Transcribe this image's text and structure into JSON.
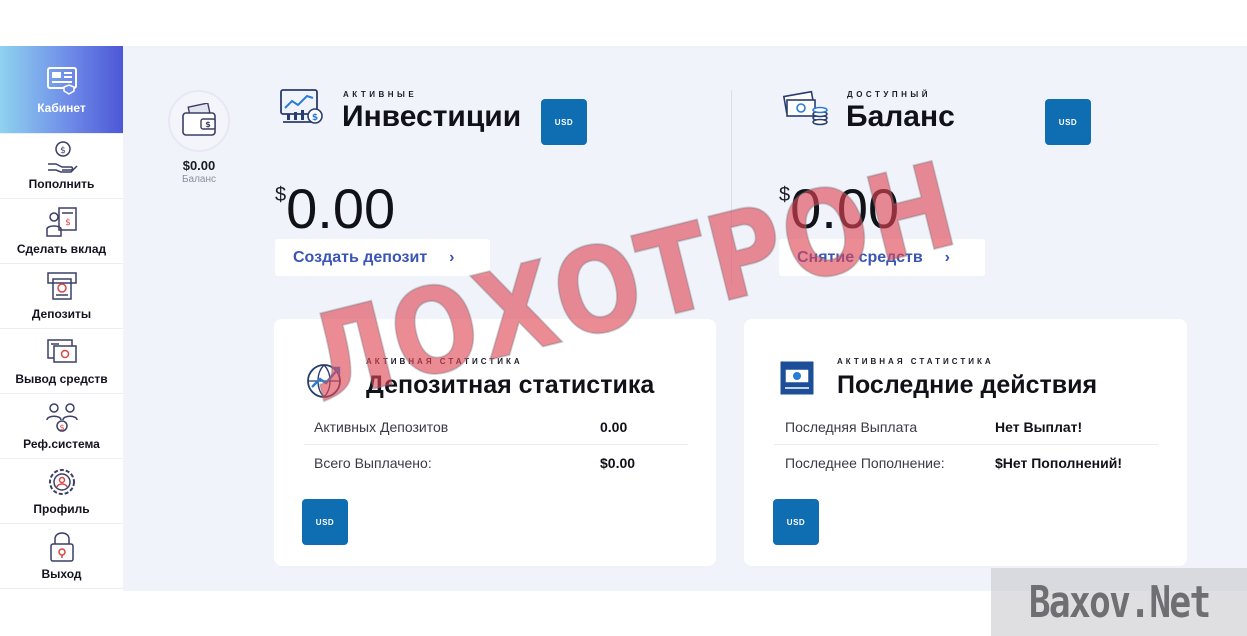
{
  "sidebar": {
    "items": [
      {
        "label": "Кабинет",
        "icon": "cabinet-icon",
        "active": true
      },
      {
        "label": "Пополнить",
        "icon": "deposit-hand-icon"
      },
      {
        "label": "Сделать вклад",
        "icon": "make-investment-icon"
      },
      {
        "label": "Депозиты",
        "icon": "deposits-atm-icon"
      },
      {
        "label": "Вывод средств",
        "icon": "withdraw-icon"
      },
      {
        "label": "Реф.система",
        "icon": "referral-icon"
      },
      {
        "label": "Профиль",
        "icon": "profile-gear-icon"
      },
      {
        "label": "Выход",
        "icon": "exit-lock-icon"
      }
    ]
  },
  "balance_widget": {
    "amount": "$0.00",
    "label": "Баланс",
    "icon": "wallet-icon"
  },
  "investments": {
    "small_title": "АКТИВНЫЕ",
    "title": "Инвестиции",
    "currency_badge": "USD",
    "currency_symbol": "$",
    "amount": "0.00",
    "button_label": "Создать депозит",
    "chevron": "›",
    "icon": "investment-chart-icon"
  },
  "available": {
    "small_title": "ДОСТУПНЫЙ",
    "title": "Баланс",
    "currency_badge": "USD",
    "currency_symbol": "$",
    "amount": "0.00",
    "button_label": "Снятие средств",
    "chevron": "›",
    "icon": "cash-coins-icon"
  },
  "deposit_stats": {
    "small_title": "АКТИВНАЯ СТАТИСТИКА",
    "title": "Депозитная статистика",
    "rows": [
      {
        "label": "Активных Депозитов",
        "value": "0.00"
      },
      {
        "label": "Всего Выплачено:",
        "value": "$0.00"
      }
    ],
    "currency_badge": "USD",
    "icon": "globe-growth-icon"
  },
  "recent_actions": {
    "small_title": "АКТИВНАЯ СТАТИСТИКА",
    "title": "Последние действия",
    "rows": [
      {
        "label": "Последняя Выплата",
        "value": "Нет Выплат!"
      },
      {
        "label": "Последнее Пополнение:",
        "value": "$Нет Пополнений!"
      }
    ],
    "currency_badge": "USD",
    "icon": "banknote-icon"
  },
  "overlay": {
    "stamp": "ЛОХОТРОН",
    "watermark": "Baxov.Net"
  },
  "colors": {
    "accent_blue": "#0f6db2",
    "link_blue": "#3a55b5",
    "stamp_red": "#de4654",
    "background": "#f1f3fb"
  }
}
